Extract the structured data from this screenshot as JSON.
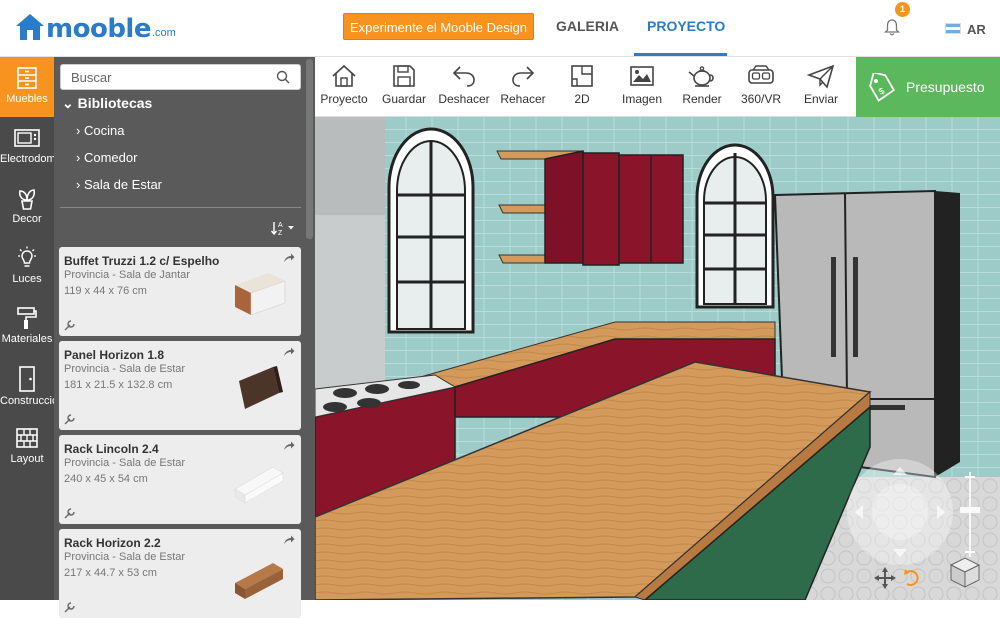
{
  "header": {
    "logo_text": "mooble",
    "logo_domain": ".com",
    "cta_label": "Experimente el Mooble Design",
    "nav": [
      {
        "label": "GALERIA"
      },
      {
        "label": "PROYECTO"
      }
    ],
    "notification_count": "1",
    "language": "AR"
  },
  "rail": [
    {
      "label": "Muebles",
      "icon": "furniture-drawer-icon"
    },
    {
      "label": "Electrodomésticos",
      "icon": "microwave-icon"
    },
    {
      "label": "Decor",
      "icon": "plant-icon"
    },
    {
      "label": "Luces",
      "icon": "lightbulb-icon"
    },
    {
      "label": "Materiales",
      "icon": "paint-roller-icon"
    },
    {
      "label": "Construcción",
      "icon": "door-icon"
    },
    {
      "label": "Layout",
      "icon": "brick-wall-icon"
    }
  ],
  "library": {
    "search_placeholder": "Buscar",
    "root": "Bibliotecas",
    "items": [
      "Cocina",
      "Comedor",
      "Sala de Estar"
    ],
    "products": [
      {
        "name": "Buffet Truzzi 1.2 c/ Espelho",
        "provider": "Provincia - Sala de Jantar",
        "dims": "119 x 44 x 76 cm"
      },
      {
        "name": "Panel Horizon 1.8",
        "provider": "Provincia - Sala de Estar",
        "dims": "181 x 21.5 x 132.8 cm"
      },
      {
        "name": "Rack Lincoln 2.4",
        "provider": "Provincia - Sala de Estar",
        "dims": "240 x 45 x 54 cm"
      },
      {
        "name": "Rack Horizon 2.2",
        "provider": "Provincia - Sala de Estar",
        "dims": "217 x 44.7 x 53 cm"
      }
    ]
  },
  "toolbar": {
    "tools": [
      {
        "label": "Proyecto",
        "icon": "home-icon"
      },
      {
        "label": "Guardar",
        "icon": "save-icon"
      },
      {
        "label": "Deshacer",
        "icon": "undo-icon"
      },
      {
        "label": "Rehacer",
        "icon": "redo-icon"
      },
      {
        "label": "2D",
        "icon": "floorplan-icon"
      },
      {
        "label": "Imagen",
        "icon": "image-icon"
      },
      {
        "label": "Render",
        "icon": "teapot-icon"
      },
      {
        "label": "360/VR",
        "icon": "vr-headset-icon"
      },
      {
        "label": "Enviar",
        "icon": "paper-plane-icon"
      }
    ],
    "budget_label": "Presupuesto"
  },
  "colors": {
    "brand_blue": "#2a7bc8",
    "accent_orange": "#f7931e",
    "budget_green": "#5cb85c",
    "rail_bg": "#4a4a4a",
    "panel_bg": "#5a5a5a"
  }
}
